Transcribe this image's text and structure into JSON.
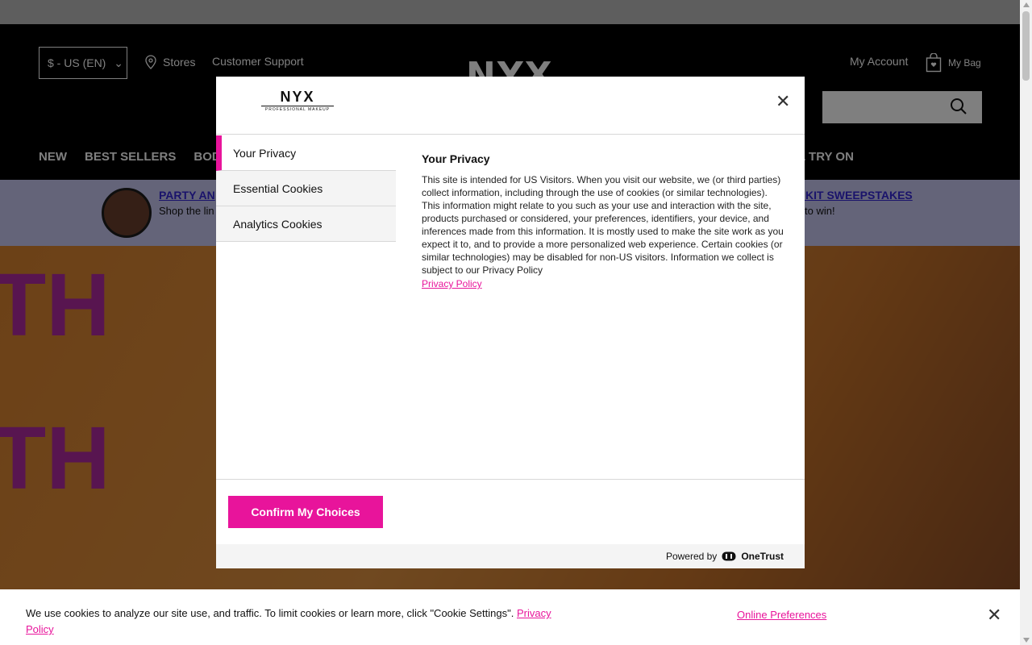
{
  "header": {
    "currency": "$ - US (EN)",
    "stores": "Stores",
    "customer_support": "Customer Support",
    "logo": "NYX",
    "my_account": "My Account",
    "my_bag": "My Bag"
  },
  "nav": {
    "items": [
      "NEW",
      "BEST SELLERS",
      "BODY"
    ],
    "right_item": "L TRY ON"
  },
  "promo": {
    "title_left": "PARTY AN",
    "sub_left": "Shop the lin",
    "title_right": "R KIT SWEEPSTAKES",
    "sub_right": "to win!"
  },
  "modal": {
    "logo_text": "NYX",
    "logo_sub": "PROFESSIONAL MAKEUP",
    "tabs": [
      {
        "label": "Your Privacy"
      },
      {
        "label": "Essential Cookies"
      },
      {
        "label": "Analytics Cookies"
      }
    ],
    "heading": "Your Privacy",
    "body": "This site is intended for US Visitors. When you visit our website, we (or third parties) collect information, including through the use of cookies (or similar technologies). This information might relate to you such as your use and interaction with the site, products purchased or considered, your preferences, identifiers, your device, and inferences made from this information. It is mostly used to make the site work as you expect it to, and to provide a more personalized web experience. Certain cookies (or similar technologies) may be disabled for non-US visitors. Information we collect is subject to our Privacy Policy",
    "privacy_link": "Privacy Policy",
    "confirm_label": "Confirm My Choices",
    "powered_by": "Powered by",
    "onetrust": "OneTrust"
  },
  "cookie_banner": {
    "text": "We use cookies to analyze our site use, and traffic. To limit cookies or learn more, click \"Cookie Settings\".",
    "privacy_link": "Privacy Policy",
    "online_preferences": "Online Preferences"
  },
  "colors": {
    "accent": "#e8149b",
    "header_bg": "#000000",
    "promo_bg": "#c9c9f3",
    "promo_link": "#3426d6"
  }
}
